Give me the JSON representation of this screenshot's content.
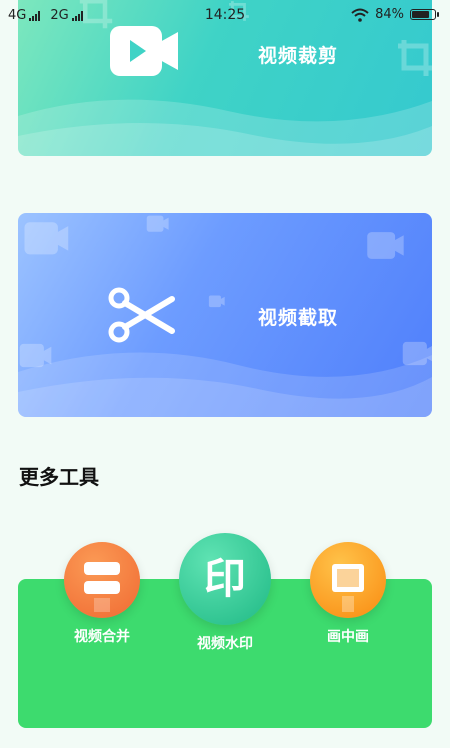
{
  "status_bar": {
    "signal_1": "4G",
    "signal_2": "2G",
    "time": "14:25",
    "battery_text": "84%",
    "battery_level": 0.84
  },
  "cards": {
    "video_cut": {
      "title": "视频裁剪",
      "icon": "video-camera-icon"
    },
    "video_grab": {
      "title": "视频截取",
      "icon": "scissors-icon"
    }
  },
  "more_tools": {
    "heading": "更多工具",
    "items": [
      {
        "label": "视频合并",
        "icon": "merge-icon"
      },
      {
        "label": "视频水印",
        "icon": "stamp-icon",
        "glyph": "印"
      },
      {
        "label": "画中画",
        "icon": "picture-in-picture-icon"
      }
    ]
  },
  "colors": {
    "cut_card_start": "#7fe8bd",
    "cut_card_end": "#35c9cf",
    "grab_card_start": "#9cc3ff",
    "grab_card_end": "#4f7ffb",
    "tools_panel": "#3ddb6e",
    "merge_circle": "#f5703a",
    "watermark_circle": "#29c98f",
    "pip_circle": "#fb9a1e"
  }
}
